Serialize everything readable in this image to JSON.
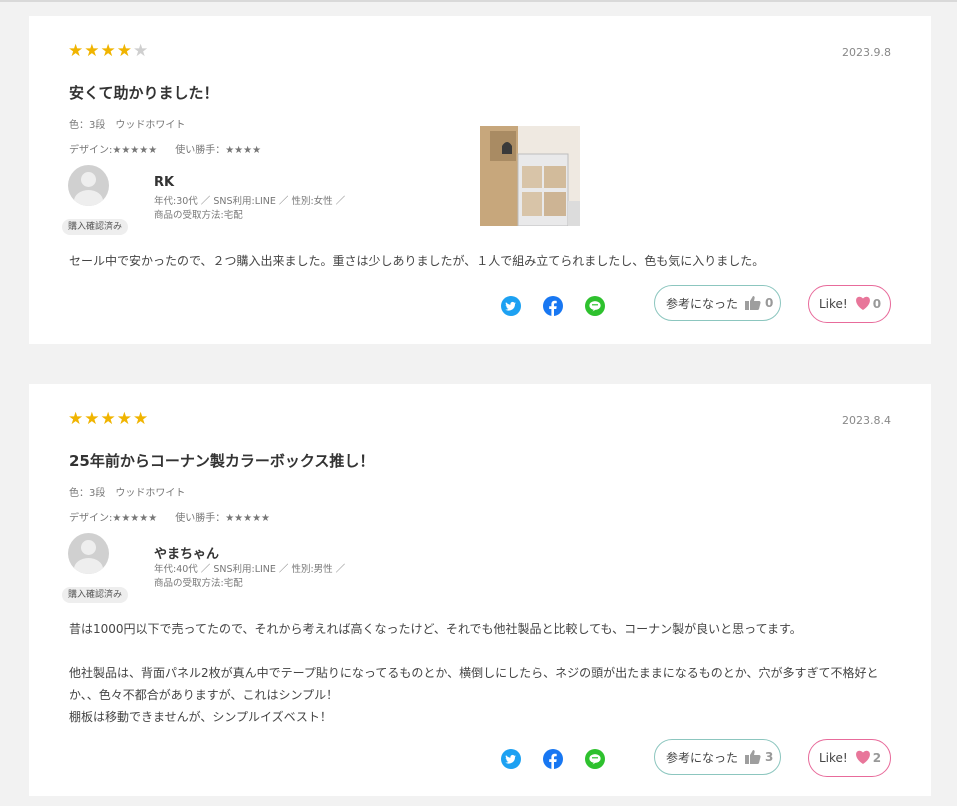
{
  "reviews": [
    {
      "rating": 4,
      "date": "2023.9.8",
      "title": "安くて助かりました！",
      "color_line": "色：3段　ウッドホワイト",
      "design": "デザイン:★★★★★",
      "usability": "使い勝手：★★★★",
      "username": "RK",
      "user_line1": "年代:30代 ／ SNS利用:LINE ／ 性別:女性 ／",
      "user_line2": "商品の受取方法:宅配",
      "badge": "購入確認済み",
      "body": [
        "セール中で安かったので、２つ購入出来ました。重さは少しありましたが、１人で組み立てられましたし、色も気に入りました。"
      ],
      "helpful_label": "参考になった",
      "helpful_count": "0",
      "like_label": "Like!",
      "like_count": "0"
    },
    {
      "rating": 5,
      "date": "2023.8.4",
      "title": "25年前からコーナン製カラーボックス推し！",
      "color_line": "色：3段　ウッドホワイト",
      "design": "デザイン:★★★★★",
      "usability": "使い勝手：★★★★★",
      "username": "やまちゃん",
      "user_line1": "年代:40代 ／ SNS利用:LINE ／ 性別:男性 ／",
      "user_line2": "商品の受取方法:宅配",
      "badge": "購入確認済み",
      "body": [
        "昔は1000円以下で売ってたので、それから考えれば高くなったけど、それでも他社製品と比較しても、コーナン製が良いと思ってます。",
        "",
        "他社製品は、背面パネル2枚が真ん中でテープ貼りになってるものとか、横倒しにしたら、ネジの頭が出たままになるものとか、穴が多すぎて不格好とか、、色々不都合がありますが、これはシンプル！",
        "棚板は移動できませんが、シンプルイズベスト！"
      ],
      "helpful_label": "参考になった",
      "helpful_count": "3",
      "like_label": "Like!",
      "like_count": "2"
    }
  ],
  "icons": {
    "star": "★",
    "twitter": "twitter-icon",
    "facebook": "facebook-icon",
    "line": "line-icon",
    "thumb": "thumbs-up-icon",
    "heart": "heart-icon"
  },
  "colors": {
    "star_on": "#f0b400",
    "star_off": "#cfcfcf",
    "helpful_border": "#8cc6bf",
    "like_border": "#e86b9b",
    "heart": "#e8769a"
  }
}
